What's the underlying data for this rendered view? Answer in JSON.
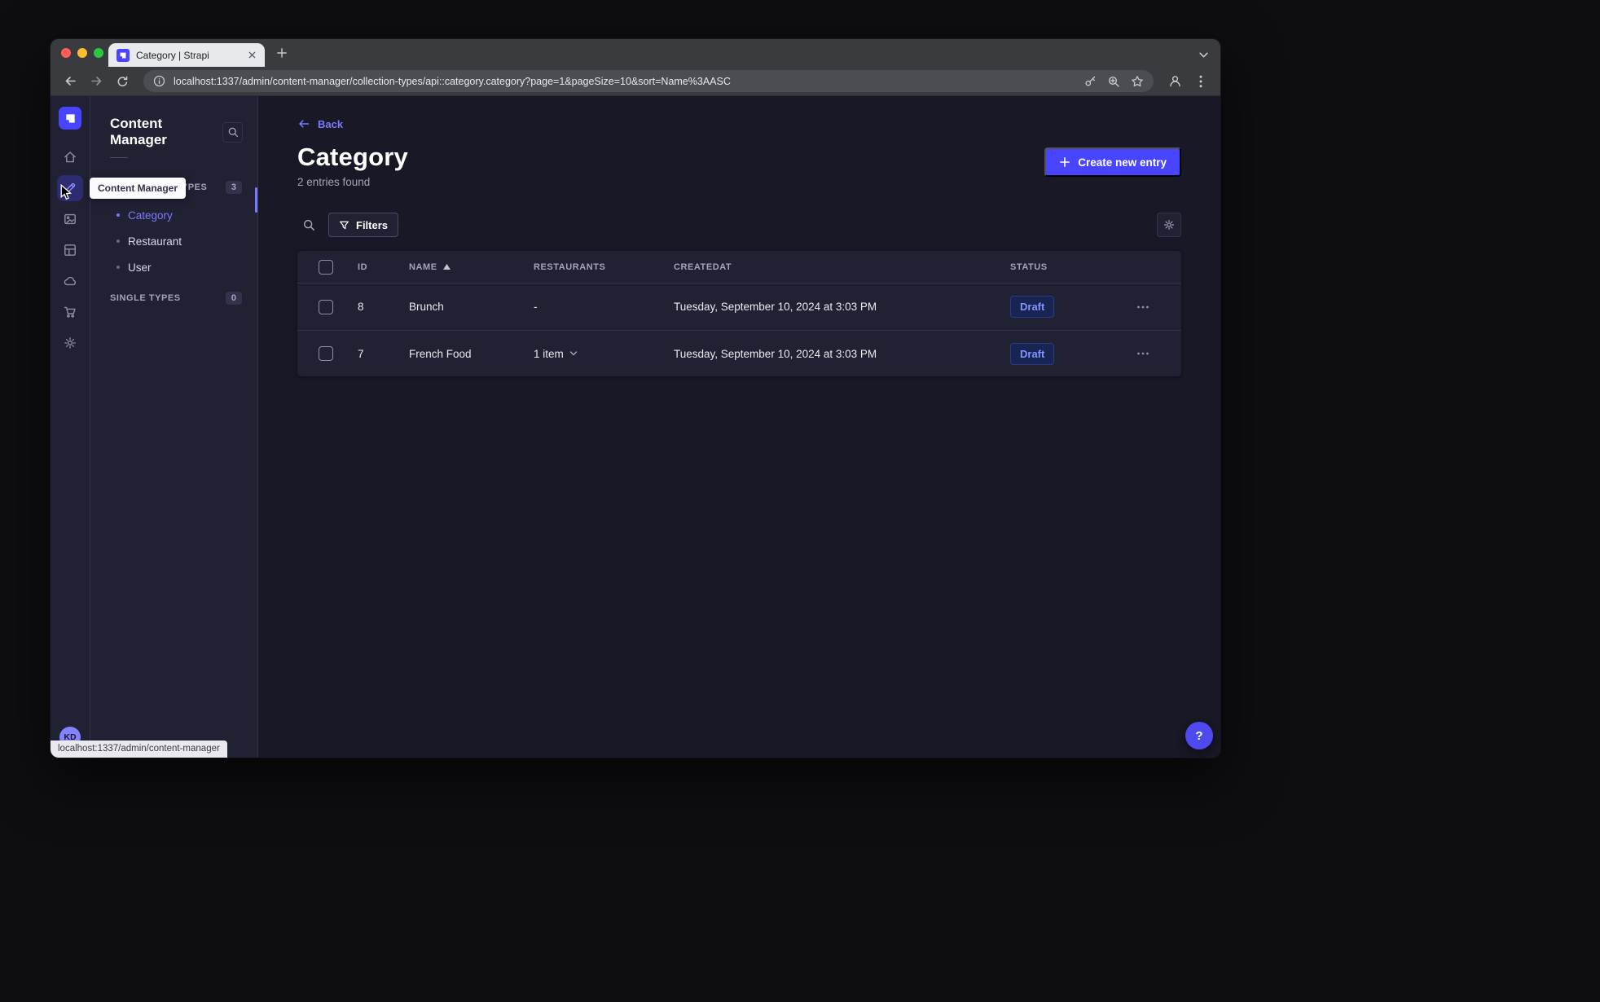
{
  "browser": {
    "tab_title": "Category | Strapi",
    "url": "localhost:1337/admin/content-manager/collection-types/api::category.category?page=1&pageSize=10&sort=Name%3AASC",
    "status_bar": "localhost:1337/admin/content-manager"
  },
  "mainnav": {
    "tooltip": "Content Manager",
    "avatar": "KD"
  },
  "subnav": {
    "title": "Content Manager",
    "collection_types": {
      "label": "COLLECTION TYPES",
      "badge": "3"
    },
    "single_types": {
      "label": "SINGLE TYPES",
      "badge": "0"
    },
    "items": [
      {
        "label": "Category",
        "active": true
      },
      {
        "label": "Restaurant",
        "active": false
      },
      {
        "label": "User",
        "active": false
      }
    ]
  },
  "page": {
    "back": "Back",
    "title": "Category",
    "entries_count": "2 entries found",
    "create_button": "Create new entry",
    "filters": "Filters"
  },
  "table": {
    "columns": {
      "id": "ID",
      "name": "NAME",
      "restaurants": "RESTAURANTS",
      "createdat": "CREATEDAT",
      "status": "STATUS"
    },
    "rows": [
      {
        "id": "8",
        "name": "Brunch",
        "restaurants": "-",
        "createdat": "Tuesday, September 10, 2024 at 3:03 PM",
        "status": "Draft"
      },
      {
        "id": "7",
        "name": "French Food",
        "restaurants": "1 item",
        "createdat": "Tuesday, September 10, 2024 at 3:03 PM",
        "status": "Draft"
      }
    ]
  },
  "help": {
    "label": "?"
  },
  "colors": {
    "primary": "#4945ff",
    "link": "#7b79ff",
    "draft": "#8195ff"
  }
}
